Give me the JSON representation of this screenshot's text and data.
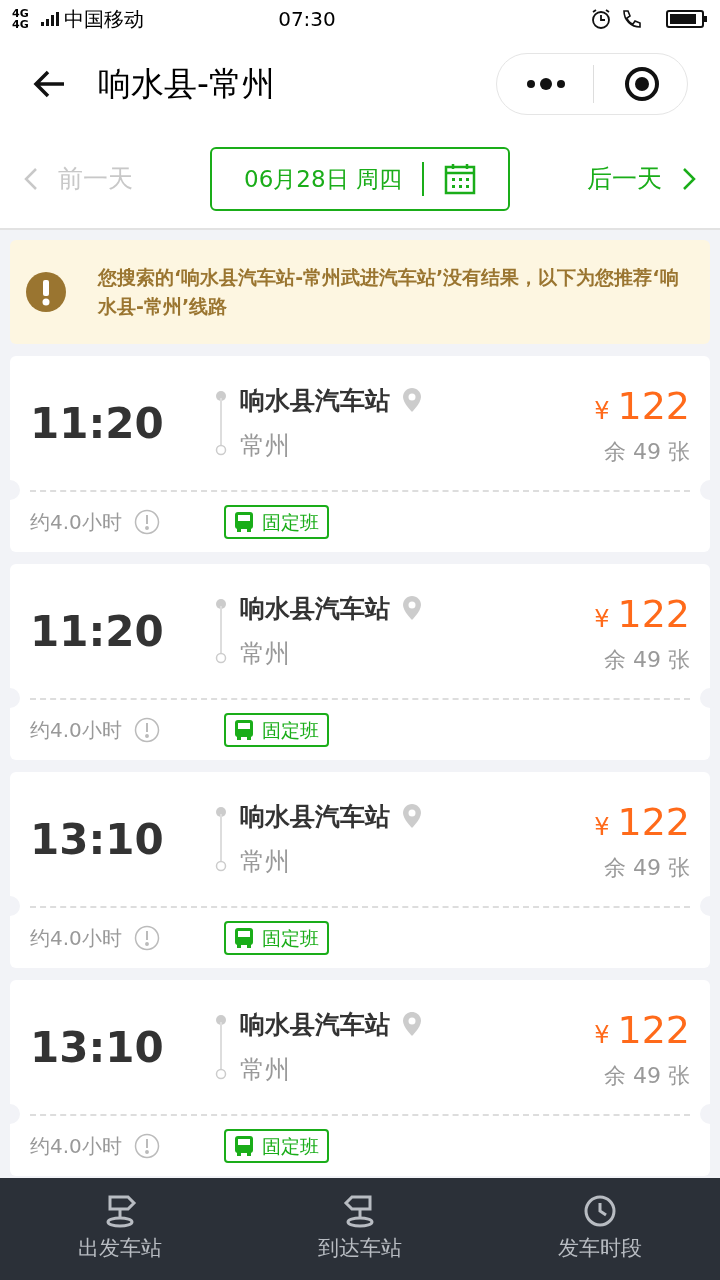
{
  "status_bar": {
    "network": "4G 4G",
    "carrier": "中国移动",
    "time": "07:30"
  },
  "header": {
    "title": "响水县-常州"
  },
  "date_bar": {
    "prev": {
      "label": "前一天",
      "disabled": true
    },
    "date": "06月28日 周四",
    "next": {
      "label": "后一天",
      "disabled": false
    }
  },
  "notice": {
    "text": "您搜索的‘响水县汽车站-常州武进汽车站’没有结果，以下为您推荐‘响水县-常州’线路"
  },
  "trips": [
    {
      "time": "11:20",
      "from": "响水县汽车站",
      "to": "常州",
      "currency": "¥",
      "price": "122",
      "seats": "余 49 张",
      "duration": "约4.0小时",
      "tag": "固定班"
    },
    {
      "time": "11:20",
      "from": "响水县汽车站",
      "to": "常州",
      "currency": "¥",
      "price": "122",
      "seats": "余 49 张",
      "duration": "约4.0小时",
      "tag": "固定班"
    },
    {
      "time": "13:10",
      "from": "响水县汽车站",
      "to": "常州",
      "currency": "¥",
      "price": "122",
      "seats": "余 49 张",
      "duration": "约4.0小时",
      "tag": "固定班"
    },
    {
      "time": "13:10",
      "from": "响水县汽车站",
      "to": "常州",
      "currency": "¥",
      "price": "122",
      "seats": "余 49 张",
      "duration": "约4.0小时",
      "tag": "固定班"
    }
  ],
  "bottom_tabs": [
    {
      "label": "出发车站",
      "kind": "depart"
    },
    {
      "label": "到达车站",
      "kind": "arrive"
    },
    {
      "label": "发车时段",
      "kind": "time"
    }
  ]
}
